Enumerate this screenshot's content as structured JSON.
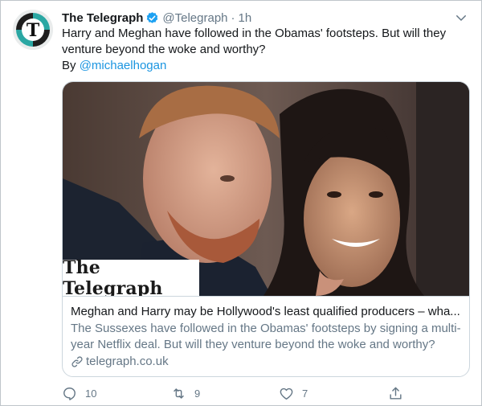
{
  "tweet": {
    "display_name": "The Telegraph",
    "handle": "@Telegraph",
    "separator": "·",
    "time": "1h",
    "text": "Harry and Meghan have followed in the Obamas' footsteps. But will they venture beyond the woke and worthy?",
    "byline_prefix": "By ",
    "byline_mention": "@michaelhogan",
    "avatar_letter": "T",
    "verified": true
  },
  "card": {
    "logo_text": "The Telegraph",
    "title": "Meghan and Harry may be Hollywood's least qualified producers – wha...",
    "description": "The Sussexes have followed in the Obamas' footsteps by signing a multi-year Netflix deal. But will they venture beyond the woke and worthy?",
    "domain": "telegraph.co.uk"
  },
  "actions": {
    "reply_count": "10",
    "retweet_count": "9",
    "like_count": "7",
    "share_count": ""
  },
  "colors": {
    "link_blue": "#1b95e0",
    "secondary_text": "#657786",
    "verified_blue": "#1da1f2",
    "card_border": "#ccd6dd"
  },
  "icons": [
    "telegraph-avatar",
    "verified-icon",
    "chevron-down-icon",
    "link-icon",
    "reply-icon",
    "retweet-icon",
    "like-icon",
    "share-icon"
  ]
}
